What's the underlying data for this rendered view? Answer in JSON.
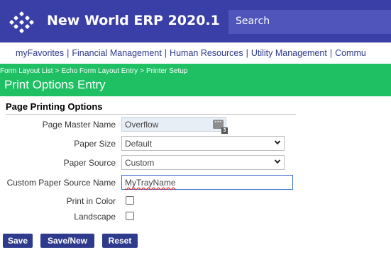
{
  "header": {
    "app_title": "New World ERP 2020.1",
    "search_label": "Search"
  },
  "nav": {
    "items": [
      "myFavorites",
      "Financial Management",
      "Human Resources",
      "Utility Management",
      "Commu"
    ]
  },
  "breadcrumb": {
    "items": [
      "Form Layout List",
      "Echo Form Layout Entry",
      "Printer Setup"
    ],
    "separator": ">"
  },
  "page": {
    "title": "Print Options Entry"
  },
  "section": {
    "title": "Page Printing Options"
  },
  "form": {
    "page_master_name": {
      "label": "Page Master Name",
      "value": "Overflow",
      "badge": "3"
    },
    "paper_size": {
      "label": "Paper Size",
      "value": "Default"
    },
    "paper_source": {
      "label": "Paper Source",
      "value": "Custom"
    },
    "custom_paper_source_name": {
      "label": "Custom Paper Source Name",
      "value": "MyTrayName"
    },
    "print_in_color": {
      "label": "Print in Color",
      "checked": false
    },
    "landscape": {
      "label": "Landscape",
      "checked": false
    }
  },
  "buttons": {
    "save": "Save",
    "save_new": "Save/New",
    "reset": "Reset"
  },
  "colors": {
    "header": "#3a3fa8",
    "band": "#1fbf64",
    "button": "#2e3a8c"
  }
}
